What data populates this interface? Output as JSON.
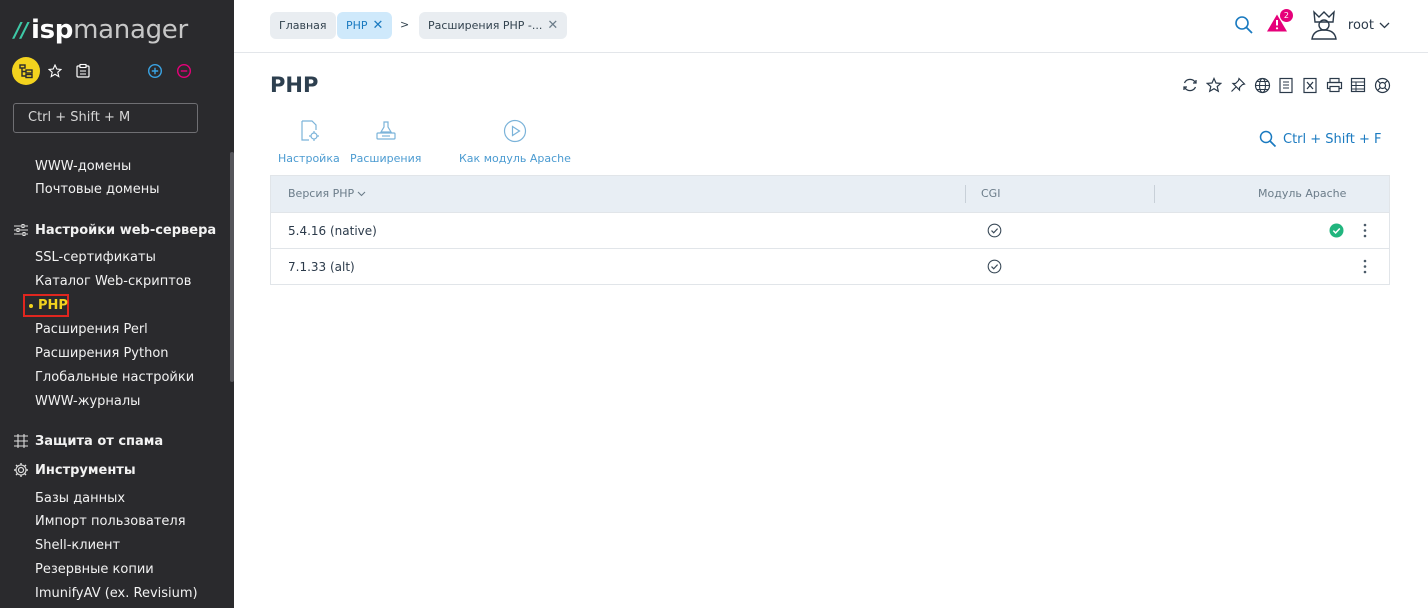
{
  "logo": {
    "bars": "//",
    "isp": "isp",
    "manager": "manager"
  },
  "sidebar": {
    "search_placeholder": "Ctrl + Shift + M",
    "items": [
      {
        "label": "WWW-домены"
      },
      {
        "label": "Почтовые домены"
      },
      {
        "label": "Настройки web-сервера",
        "group": true
      },
      {
        "label": "SSL-сертификаты"
      },
      {
        "label": "Каталог Web-скриптов"
      },
      {
        "label": "PHP",
        "active": true
      },
      {
        "label": "Расширения Perl"
      },
      {
        "label": "Расширения Python"
      },
      {
        "label": "Глобальные настройки"
      },
      {
        "label": "WWW-журналы"
      },
      {
        "label": "Защита от спама",
        "group": true
      },
      {
        "label": "Инструменты",
        "group": true
      },
      {
        "label": "Базы данных"
      },
      {
        "label": "Импорт пользователя"
      },
      {
        "label": "Shell-клиент"
      },
      {
        "label": "Резервные копии"
      },
      {
        "label": "ImunifyAV (ex. Revisium)"
      }
    ]
  },
  "breadcrumbs": [
    {
      "label": "Главная"
    },
    {
      "label": "PHP",
      "active": true
    },
    {
      "separator": ">"
    },
    {
      "label": "Расширения PHP -..."
    }
  ],
  "header": {
    "notifications_count": "2",
    "user": "root"
  },
  "page": {
    "title": "PHP",
    "actions": [
      {
        "label": "Настройка",
        "icon": "settings-doc-icon"
      },
      {
        "label": "Расширения",
        "icon": "extensions-icon"
      },
      {
        "label": "Как модуль Apache",
        "icon": "play-icon"
      }
    ],
    "table_search": "Ctrl + Shift + F"
  },
  "table": {
    "columns": [
      "Версия PHP",
      "CGI",
      "Модуль Apache"
    ],
    "rows": [
      {
        "version": "5.4.16 (native)",
        "cgi": true,
        "apache": true
      },
      {
        "version": "7.1.33 (alt)",
        "cgi": true,
        "apache": false
      }
    ]
  },
  "colors": {
    "accent": "#1a7ac0",
    "sidebar_bg": "#2a2a2d",
    "active_yellow": "#f3d31e",
    "success": "#21b57e",
    "alert": "#e6007a"
  }
}
